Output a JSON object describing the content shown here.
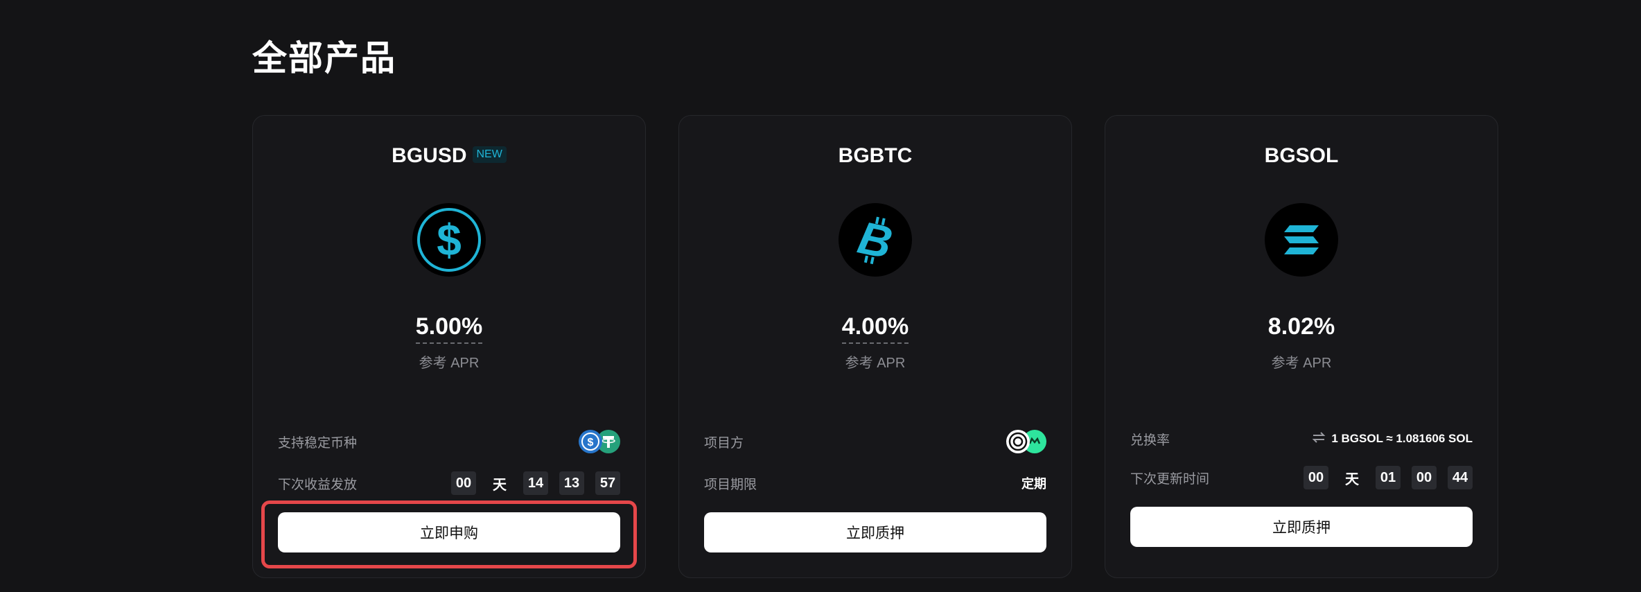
{
  "page": {
    "title": "全部产品"
  },
  "cards": [
    {
      "name": "BGUSD",
      "badge": "NEW",
      "apr": "5.00%",
      "apr_label": "参考 APR",
      "rows": [
        {
          "label": "支持稳定币种"
        },
        {
          "label": "下次收益发放",
          "countdown": [
            "00",
            "天",
            "14",
            "13",
            "57"
          ]
        }
      ],
      "button": "立即申购",
      "icon": "dollar-icon"
    },
    {
      "name": "BGBTC",
      "apr": "4.00%",
      "apr_label": "参考 APR",
      "rows": [
        {
          "label": "项目方"
        },
        {
          "label": "项目期限",
          "value": "定期"
        }
      ],
      "button": "立即质押",
      "icon": "bitcoin-icon"
    },
    {
      "name": "BGSOL",
      "apr": "8.02%",
      "apr_label": "参考 APR",
      "rows": [
        {
          "label": "兑换率",
          "value": "1 BGSOL ≈ 1.081606 SOL"
        },
        {
          "label": "下次更新时间",
          "countdown": [
            "00",
            "天",
            "01",
            "00",
            "44"
          ]
        }
      ],
      "button": "立即质押",
      "icon": "solana-icon"
    }
  ],
  "colors": {
    "accent": "#1fb4d6",
    "highlight": "#e5474a",
    "background": "#141416"
  }
}
